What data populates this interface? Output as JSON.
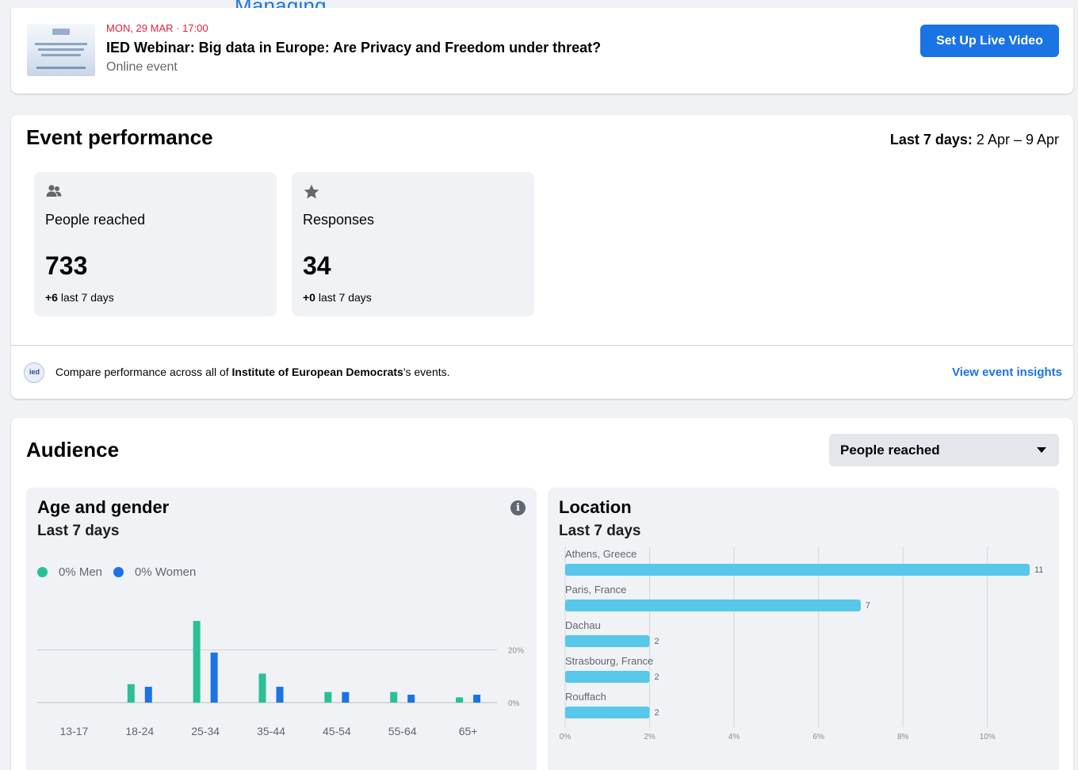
{
  "page": {
    "partial_heading": "Managing"
  },
  "event": {
    "date": "MON, 29 MAR · 17:00",
    "title": "IED Webinar: Big data in Europe: Are Privacy and Freedom under threat?",
    "subtitle": "Online event",
    "live_button": "Set Up Live Video"
  },
  "performance": {
    "title": "Event performance",
    "range_label": "Last 7 days:",
    "range_value": "2 Apr – 9 Apr",
    "metrics": [
      {
        "icon": "people-icon",
        "label": "People reached",
        "value": "733",
        "delta": "+6",
        "delta_suffix": "last 7 days"
      },
      {
        "icon": "star-icon",
        "label": "Responses",
        "value": "34",
        "delta": "+0",
        "delta_suffix": "last 7 days"
      }
    ],
    "compare_prefix": "Compare performance across all of",
    "compare_org": "Institute of European Democrats",
    "compare_suffix": "'s events.",
    "insights_link": "View event insights"
  },
  "audience": {
    "title": "Audience",
    "dropdown_value": "People reached",
    "age_gender": {
      "title": "Age and gender",
      "subtitle": "Last 7 days",
      "legend_men": "0% Men",
      "legend_women": "0% Women"
    },
    "location": {
      "title": "Location",
      "subtitle": "Last 7 days"
    }
  },
  "colors": {
    "men": "#2bbf97",
    "women": "#1b74e4",
    "location_bar": "#57c7ea",
    "accent": "#1b74e4",
    "date_red": "#e41e3f"
  },
  "chart_data": [
    {
      "type": "bar",
      "title": "Age and gender",
      "categories": [
        "13-17",
        "18-24",
        "25-34",
        "35-44",
        "45-54",
        "55-64",
        "65+"
      ],
      "series": [
        {
          "name": "Men",
          "values": [
            0,
            7,
            31,
            11,
            4,
            4,
            2
          ]
        },
        {
          "name": "Women",
          "values": [
            0,
            6,
            19,
            6,
            4,
            3,
            3
          ]
        }
      ],
      "y_ticks": [
        "0%",
        "20%"
      ],
      "ylim": [
        0,
        31
      ]
    },
    {
      "type": "bar",
      "orientation": "horizontal",
      "title": "Location",
      "categories": [
        "Athens, Greece",
        "Paris, France",
        "Dachau",
        "Strasbourg, France",
        "Rouffach"
      ],
      "values": [
        11,
        7,
        2,
        2,
        2
      ],
      "x_ticks": [
        "0%",
        "2%",
        "4%",
        "6%",
        "8%",
        "10%"
      ],
      "xlim": [
        0,
        11
      ]
    }
  ]
}
